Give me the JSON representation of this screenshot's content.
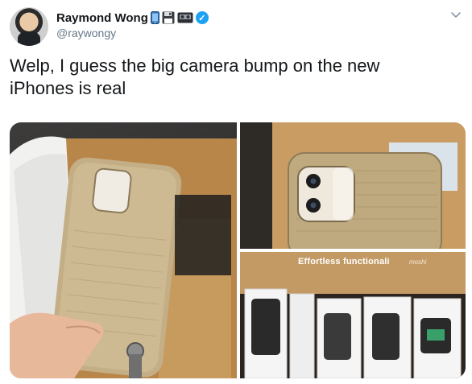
{
  "author": {
    "display_name": "Raymond Wong",
    "handle": "@raywongy",
    "verified": true
  },
  "name_emojis": [
    "mobile-phone-icon",
    "floppy-disk-icon",
    "videocassette-icon"
  ],
  "tweet": {
    "text_line1": "Welp, I guess the big camera bump on the new",
    "text_line2": "iPhones is real"
  },
  "media": {
    "photo3_overlay": "Effortless functionali",
    "photo3_brand": "moshi"
  },
  "colors": {
    "accent": "#1da1f2",
    "text": "#14171a",
    "secondary": "#657786"
  }
}
